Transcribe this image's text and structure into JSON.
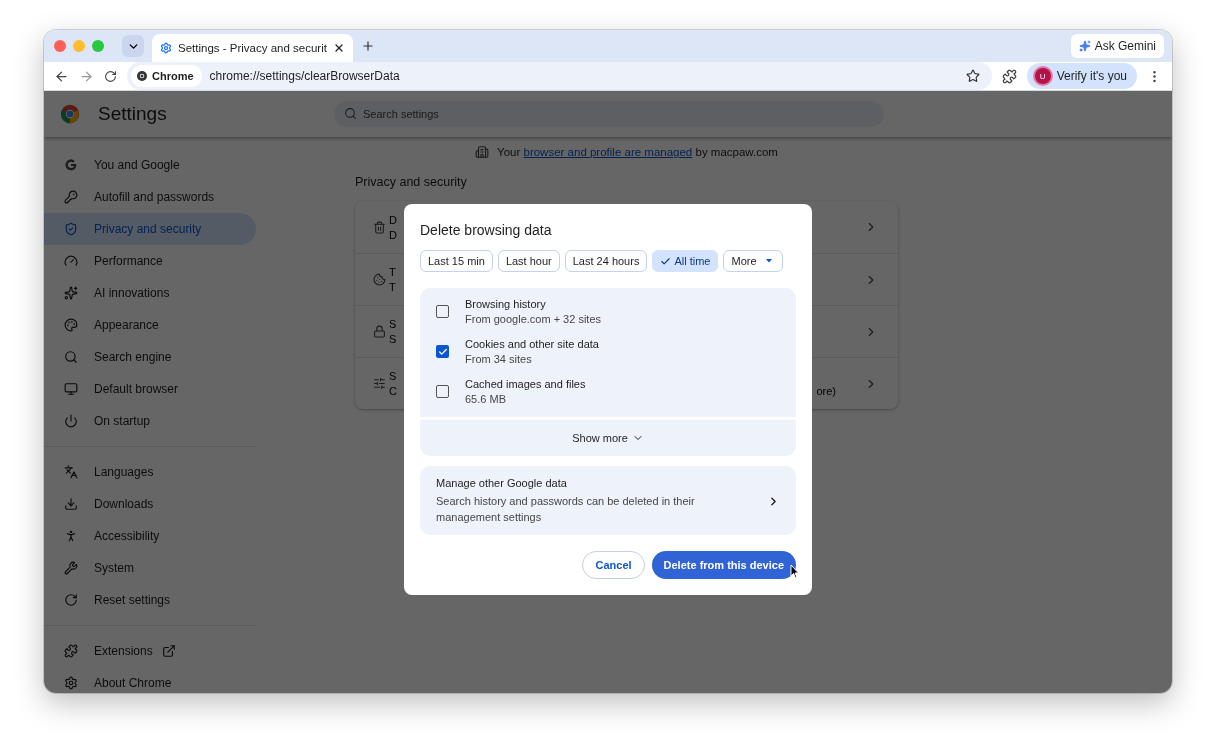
{
  "browser": {
    "tab_title": "Settings - Privacy and securit",
    "ask_gemini": "Ask Gemini",
    "site_chip": "Chrome",
    "url": "chrome://settings/clearBrowserData",
    "verify": "Verify it's you",
    "avatar_initial": "U"
  },
  "settings": {
    "title": "Settings",
    "search": {
      "placeholder": "Search settings"
    }
  },
  "sidebar": {
    "sections": [
      {
        "items": [
          {
            "label": "You and Google",
            "selected": false
          },
          {
            "label": "Autofill and passwords",
            "selected": false
          },
          {
            "label": "Privacy and security",
            "selected": true
          },
          {
            "label": "Performance",
            "selected": false
          },
          {
            "label": "AI innovations",
            "selected": false
          },
          {
            "label": "Appearance",
            "selected": false
          },
          {
            "label": "Search engine",
            "selected": false
          },
          {
            "label": "Default browser",
            "selected": false
          },
          {
            "label": "On startup",
            "selected": false
          }
        ]
      },
      {
        "items": [
          {
            "label": "Languages",
            "selected": false
          },
          {
            "label": "Downloads",
            "selected": false
          },
          {
            "label": "Accessibility",
            "selected": false
          },
          {
            "label": "System",
            "selected": false
          },
          {
            "label": "Reset settings",
            "selected": false
          }
        ]
      },
      {
        "items": [
          {
            "label": "Extensions",
            "selected": false,
            "external": true
          },
          {
            "label": "About Chrome",
            "selected": false
          }
        ]
      }
    ]
  },
  "managed_notice": {
    "before": "Your",
    "link": "browser and profile are managed",
    "after": "by macpaw.com"
  },
  "section_title": "Privacy and security",
  "card_rows": [
    {
      "title": "D",
      "subtitle": "D"
    },
    {
      "title": "T",
      "subtitle": "T"
    },
    {
      "title": "S",
      "subtitle": "S"
    },
    {
      "title": "S",
      "subtitle": "C",
      "subtitle_end": "ore)"
    }
  ],
  "dialog": {
    "title": "Delete browsing data",
    "time_ranges": [
      {
        "label": "Last 15 min",
        "selected": false,
        "kind": "chip"
      },
      {
        "label": "Last hour",
        "selected": false,
        "kind": "chip"
      },
      {
        "label": "Last 24 hours",
        "selected": false,
        "kind": "chip"
      },
      {
        "label": "All time",
        "selected": true,
        "kind": "chip"
      },
      {
        "label": "More",
        "selected": false,
        "kind": "dropdown"
      }
    ],
    "data_types": [
      {
        "title": "Browsing history",
        "detail": "From google.com + 32 sites",
        "checked": false
      },
      {
        "title": "Cookies and other site data",
        "detail": "From 34 sites",
        "checked": true
      },
      {
        "title": "Cached images and files",
        "detail": "65.6 MB",
        "checked": false
      }
    ],
    "show_more": "Show more",
    "manage": {
      "title": "Manage other Google data",
      "text": "Search history and passwords can be deleted in their management settings"
    },
    "cancel": "Cancel",
    "confirm": "Delete from this device"
  }
}
